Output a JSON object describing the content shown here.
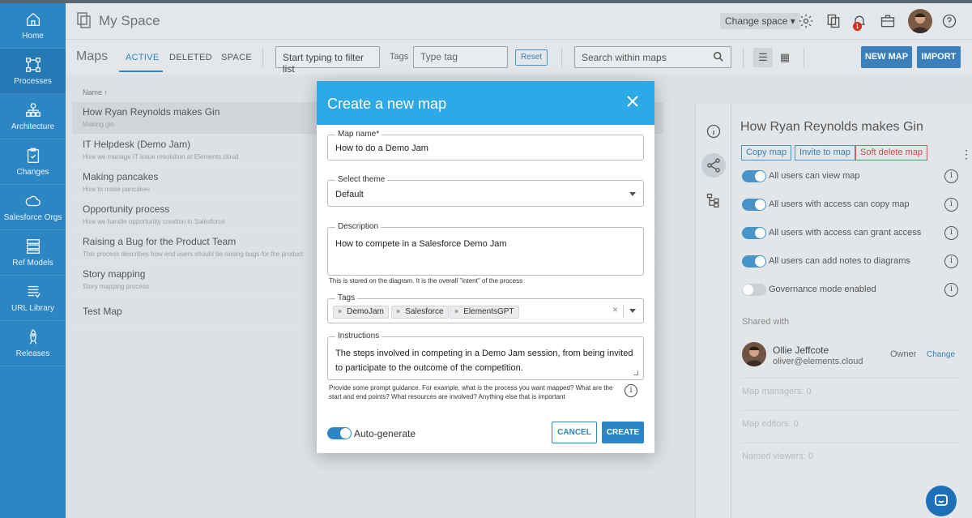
{
  "sidebar": {
    "items": [
      {
        "label": "Home",
        "icon": "home-icon"
      },
      {
        "label": "Processes",
        "icon": "process-flow-icon"
      },
      {
        "label": "Architecture",
        "icon": "architecture-icon"
      },
      {
        "label": "Changes",
        "icon": "clipboard-icon"
      },
      {
        "label": "Salesforce Orgs",
        "icon": "cloud-icon"
      },
      {
        "label": "Ref Models",
        "icon": "ref-model-icon"
      },
      {
        "label": "URL Library",
        "icon": "url-library-icon"
      },
      {
        "label": "Releases",
        "icon": "rocket-icon"
      }
    ]
  },
  "header": {
    "title": "My Space",
    "change_space": "Change space ▾",
    "notification_count": "1"
  },
  "toolbar": {
    "maps_title": "Maps",
    "tabs": [
      "ACTIVE",
      "DELETED",
      "SPACE"
    ],
    "filter_placeholder": "Start typing to filter list",
    "tags_label": "Tags",
    "tag_placeholder": "Type tag",
    "reset_label": "Reset",
    "search_placeholder": "Search within maps",
    "new_map_label": "NEW MAP",
    "import_label": "IMPORT"
  },
  "list": {
    "header": "Name ↑",
    "items": [
      {
        "title": "How Ryan Reynolds makes Gin",
        "sub": "Making gin"
      },
      {
        "title": "IT Helpdesk (Demo Jam)",
        "sub": "How we manage IT issue resolution at Elements.cloud"
      },
      {
        "title": "Making pancakes",
        "sub": "How to make pancakes"
      },
      {
        "title": "Opportunity process",
        "sub": "How we handle opportunity creation in Salesforce"
      },
      {
        "title": "Raising a Bug for the Product Team",
        "sub": "This process describes how end users should be raising bugs for the product"
      },
      {
        "title": "Story mapping",
        "sub": "Story mapping process"
      },
      {
        "title": "Test Map",
        "sub": ""
      }
    ]
  },
  "right_panel": {
    "title": "How Ryan Reynolds makes Gin",
    "copy_label": "Copy map",
    "invite_label": "Invite to map",
    "delete_label": "Soft delete map",
    "permissions": [
      {
        "label": "All users can view map",
        "on": true
      },
      {
        "label": "All users with access can copy map",
        "on": true
      },
      {
        "label": "All users with access can grant access",
        "on": true
      },
      {
        "label": "All users can add notes to diagrams",
        "on": true
      },
      {
        "label": "Governance mode enabled",
        "on": false
      }
    ],
    "shared_with": "Shared with",
    "owner": {
      "name": "Ollie Jeffcote",
      "email": "oliver@elements.cloud",
      "role": "Owner",
      "change": "Change"
    },
    "sections": [
      "Map managers: 0",
      "Map editors: 0",
      "Named viewers: 0"
    ]
  },
  "modal": {
    "title": "Create a new map",
    "map_name_label": "Map name*",
    "map_name_value": "How to do a Demo Jam",
    "theme_label": "Select theme",
    "theme_value": "Default",
    "description_label": "Description",
    "description_value": "How to compete in a Salesforce Demo Jam",
    "description_help": "This is stored on the diagram. It is the overall \"intent\" of the process",
    "tags_label": "Tags",
    "tags": [
      "DemoJam",
      "Salesforce",
      "ElementsGPT"
    ],
    "instructions_label": "Instructions",
    "instructions_line1": "The steps involved in competing in a Demo Jam session, from being invited",
    "instructions_line2": "to participate to the outcome of the competition.",
    "instructions_help_line1": "Provide some prompt guidance. For example, what is the process you want mapped? What are the",
    "instructions_help_line2": "start and end points?  What resources are involved? Anything else that is important",
    "auto_generate_label": "Auto-generate",
    "cancel_label": "CANCEL",
    "create_label": "CREATE"
  }
}
